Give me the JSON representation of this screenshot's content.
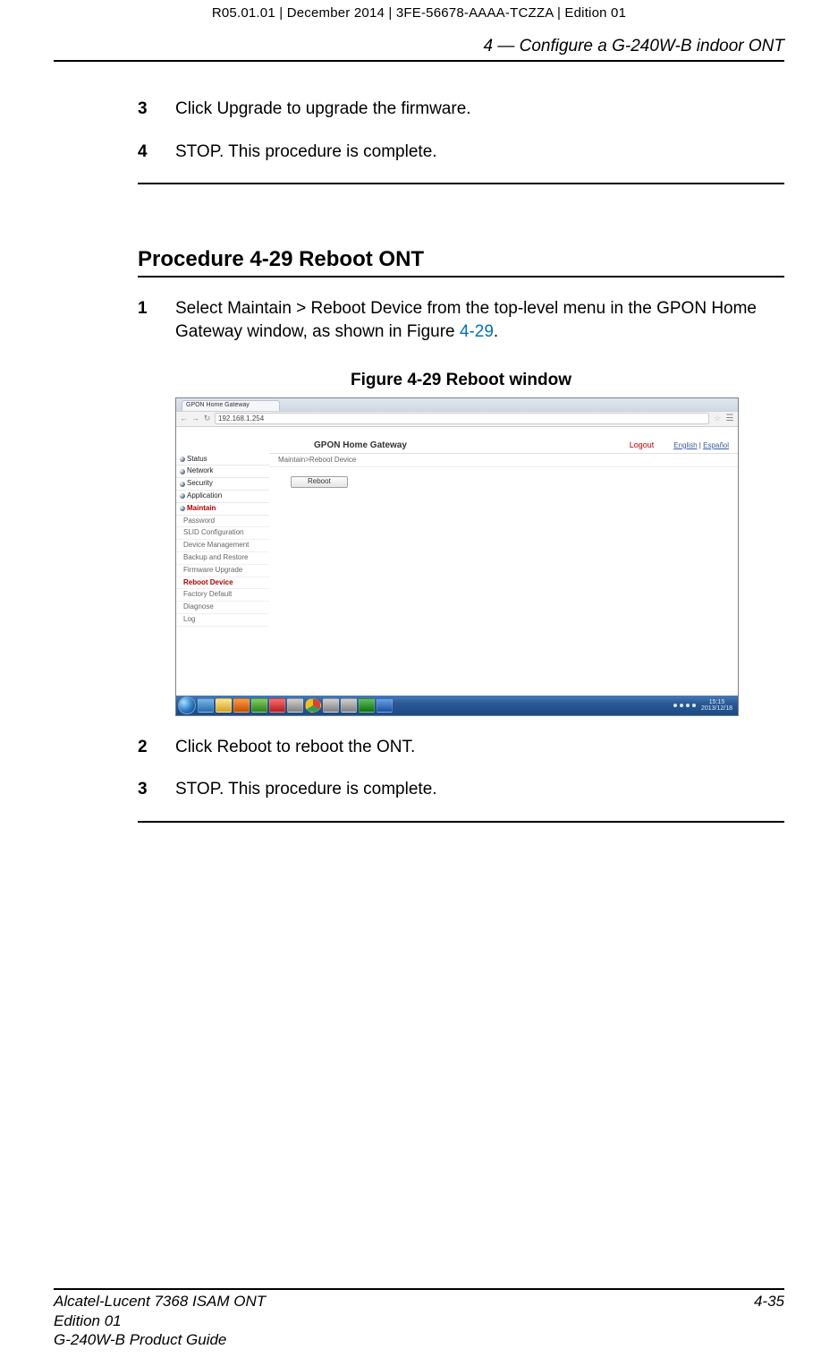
{
  "header": {
    "top_line": "R05.01.01 | December 2014 | 3FE-56678-AAAA-TCZZA | Edition 01",
    "running_head": "4 —  Configure a G-240W-B indoor ONT"
  },
  "steps_prev": [
    {
      "num": "3",
      "text": "Click Upgrade to upgrade the firmware."
    },
    {
      "num": "4",
      "text": "STOP. This procedure is complete."
    }
  ],
  "procedure": {
    "title": "Procedure 4-29  Reboot ONT",
    "step1_num": "1",
    "step1_text_a": "Select Maintain > Reboot Device from the top-level menu in the GPON Home Gateway window, as shown in Figure ",
    "step1_xref": "4-29",
    "step1_text_b": ".",
    "figure_caption": "Figure 4-29  Reboot window"
  },
  "screenshot": {
    "tab_label": "GPON Home Gateway",
    "url": "192.168.1.254",
    "app_title": "GPON Home Gateway",
    "logout": "Logout",
    "lang_en": "English",
    "lang_es": "Español",
    "breadcrumb": "Maintain>Reboot Device",
    "reboot_btn": "Reboot",
    "sidebar_cats": [
      "Status",
      "Network",
      "Security",
      "Application",
      "Maintain"
    ],
    "sidebar_subs": [
      "Password",
      "SLID Configuration",
      "Device Management",
      "Backup and Restore",
      "Firmware Upgrade",
      "Reboot Device",
      "Factory Default",
      "Diagnose",
      "Log"
    ],
    "time": "15:15",
    "date": "2013/12/18"
  },
  "steps_after": [
    {
      "num": "2",
      "text": "Click Reboot to reboot the ONT."
    },
    {
      "num": "3",
      "text": "STOP. This procedure is complete."
    }
  ],
  "footer": {
    "left1": "Alcatel-Lucent 7368 ISAM ONT",
    "left2": "Edition 01",
    "left3": "G-240W-B Product Guide",
    "right": "4-35"
  }
}
